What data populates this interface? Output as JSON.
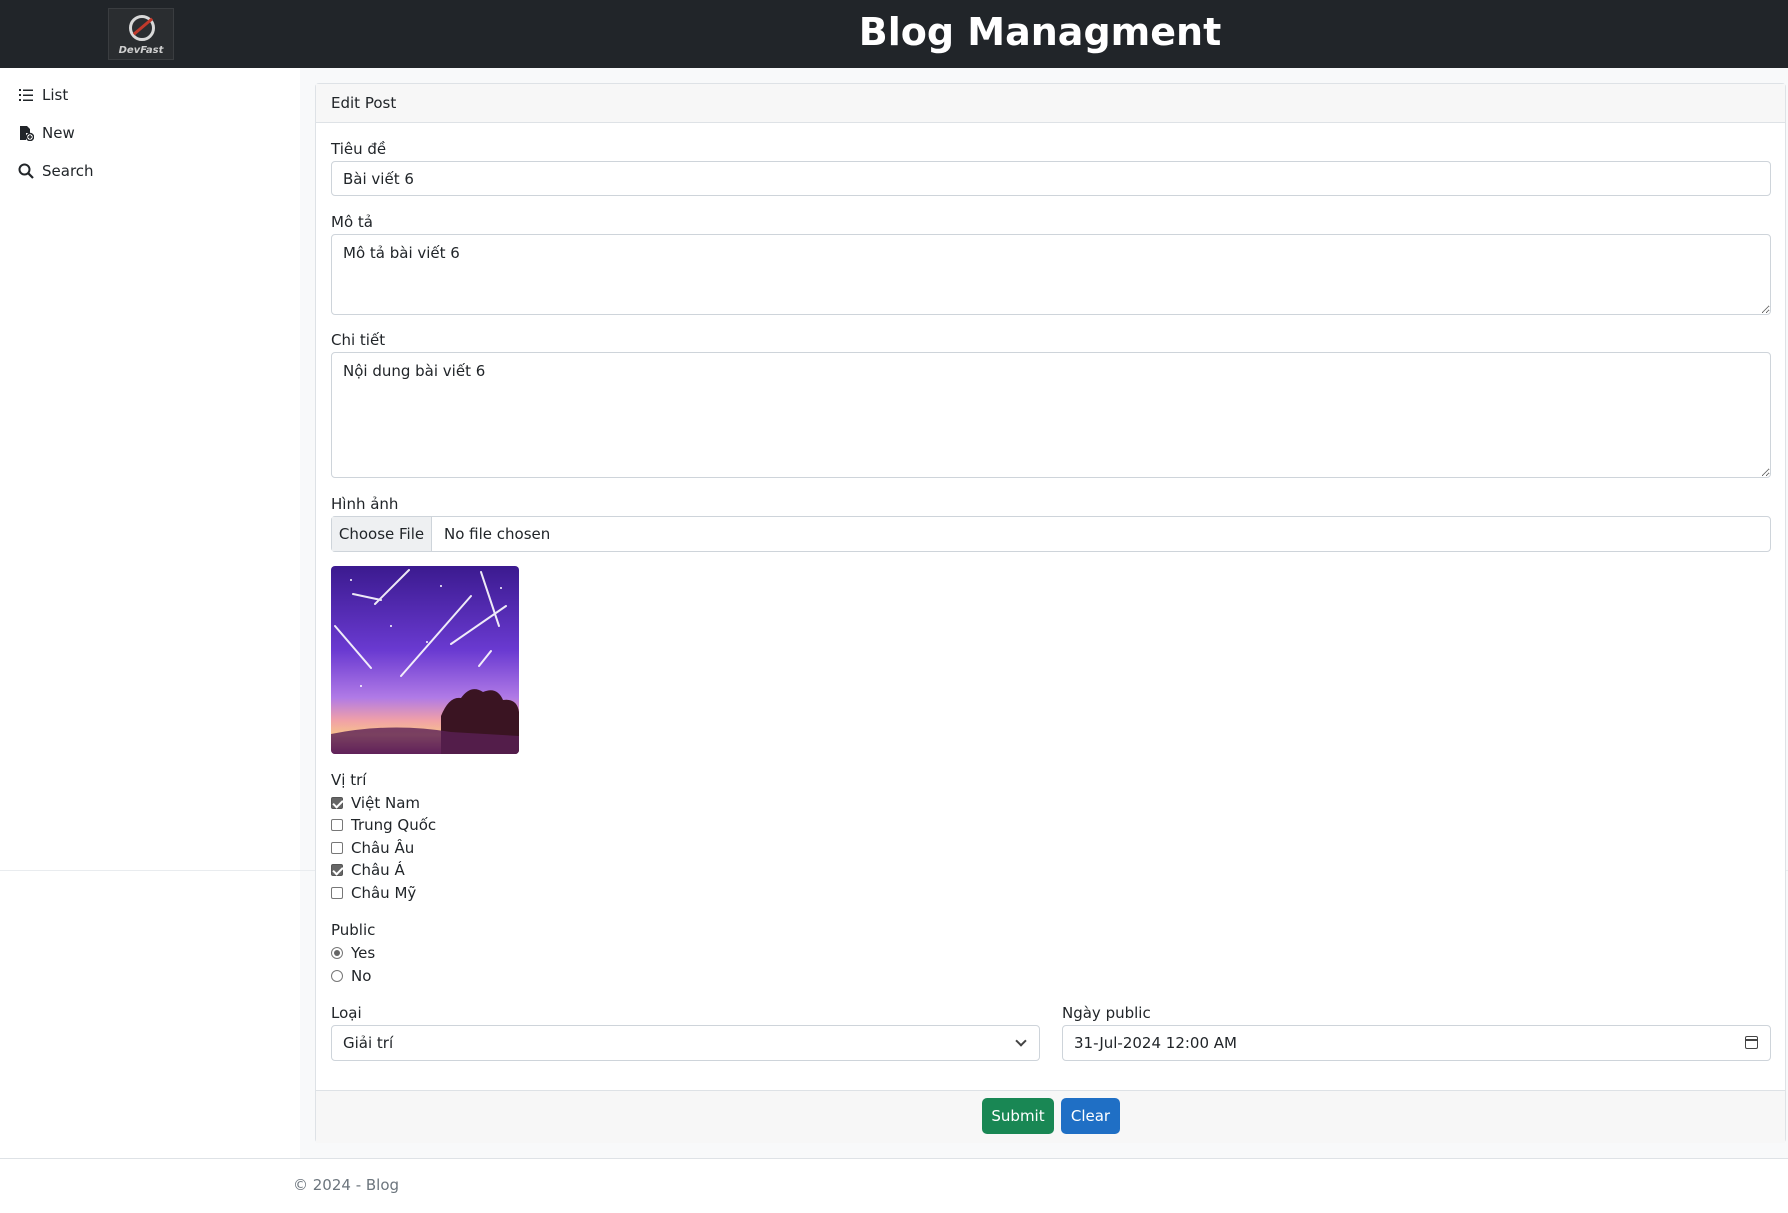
{
  "header": {
    "title": "Blog Managment",
    "logo_text": "DevFast"
  },
  "sidebar": {
    "items": [
      {
        "label": "List",
        "icon": "list-icon"
      },
      {
        "label": "New",
        "icon": "file-add-icon"
      },
      {
        "label": "Search",
        "icon": "search-icon"
      }
    ]
  },
  "form": {
    "header": "Edit Post",
    "title_label": "Tiêu đề",
    "title_value": "Bài viết 6",
    "desc_label": "Mô tả",
    "desc_value": "Mô tả bài viết 6",
    "detail_label": "Chi tiết",
    "detail_value": "Nội dung bài viết 6",
    "image_label": "Hình ảnh",
    "file_button": "Choose File",
    "file_status": "No file chosen",
    "position_label": "Vị trí",
    "positions": [
      {
        "label": "Việt Nam",
        "checked": true
      },
      {
        "label": "Trung Quốc",
        "checked": false
      },
      {
        "label": "Châu Âu",
        "checked": false
      },
      {
        "label": "Châu Á",
        "checked": true
      },
      {
        "label": "Châu Mỹ",
        "checked": false
      }
    ],
    "public_label": "Public",
    "public_options": [
      {
        "label": "Yes",
        "checked": true
      },
      {
        "label": "No",
        "checked": false
      }
    ],
    "category_label": "Loại",
    "category_value": "Giải trí",
    "date_label": "Ngày public",
    "date_value": "31-Jul-2024 12:00 AM"
  },
  "buttons": {
    "submit": "Submit",
    "clear": "Clear",
    "submit_color": "#198754",
    "clear_color": "#1f6fc5"
  },
  "footer": {
    "text": "© 2024 - Blog"
  }
}
